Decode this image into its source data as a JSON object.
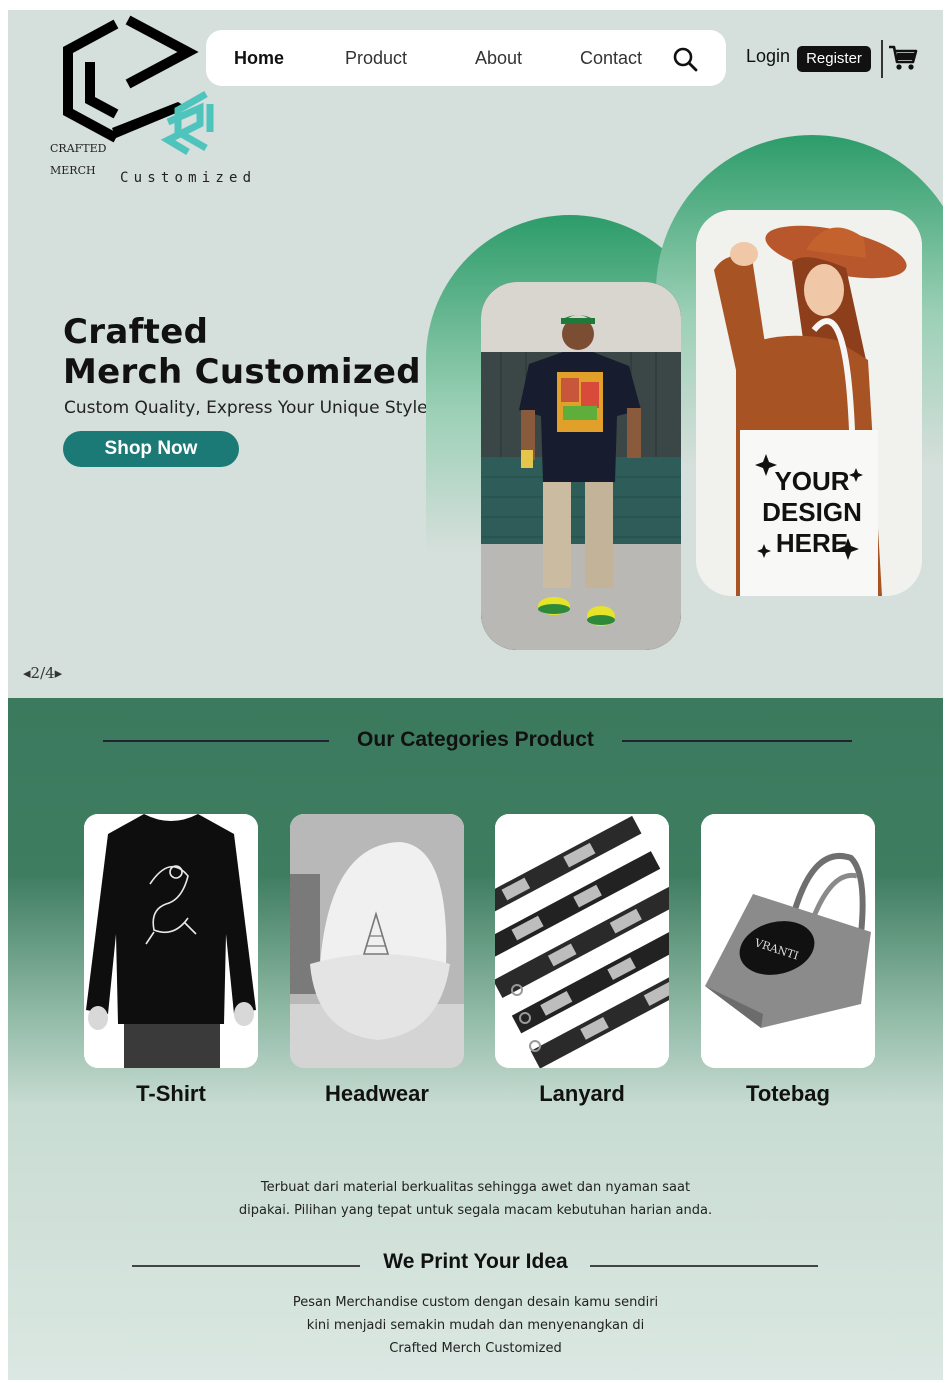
{
  "brand": {
    "logo_line1": "CRAFTED",
    "logo_line2": "MERCH",
    "logo_tagline": "Customized"
  },
  "nav": {
    "items": [
      {
        "label": "Home",
        "active": true
      },
      {
        "label": "Product",
        "active": false
      },
      {
        "label": "About",
        "active": false
      },
      {
        "label": "Contact",
        "active": false
      }
    ],
    "search_icon": "search-icon",
    "login_label": "Login",
    "register_label": "Register",
    "cart_icon": "cart-icon"
  },
  "hero": {
    "title_line1": "Crafted",
    "title_line2": "Merch Customized",
    "subtitle": "Custom Quality, Express Your Unique Style",
    "cta_label": "Shop Now",
    "tote_text": [
      "YOUR",
      "DESIGN",
      "HERE"
    ],
    "pager": "2/4"
  },
  "categories": {
    "title": "Our Categories Product",
    "items": [
      {
        "label": "T-Shirt"
      },
      {
        "label": "Headwear"
      },
      {
        "label": "Lanyard"
      },
      {
        "label": "Totebag",
        "logo_text": "VRANTI"
      }
    ],
    "description_lines": [
      "Terbuat dari material berkualitas sehingga awet dan nyaman saat",
      "dipakai. Pilihan yang tepat untuk segala macam kebutuhan harian anda."
    ],
    "print_title": "We Print Your Idea",
    "print_lines": [
      "Pesan Merchandise custom dengan desain kamu sendiri",
      "kini menjadi semakin mudah dan menyenangkan di",
      "Crafted Merch Customized"
    ]
  },
  "colors": {
    "hero_bg": "#d5dfdb",
    "accent_teal": "#1b7a76",
    "arch_green": "#2d9c6a",
    "section_green": "#3b7a5e",
    "logo_cyan": "#4fc4bd"
  }
}
